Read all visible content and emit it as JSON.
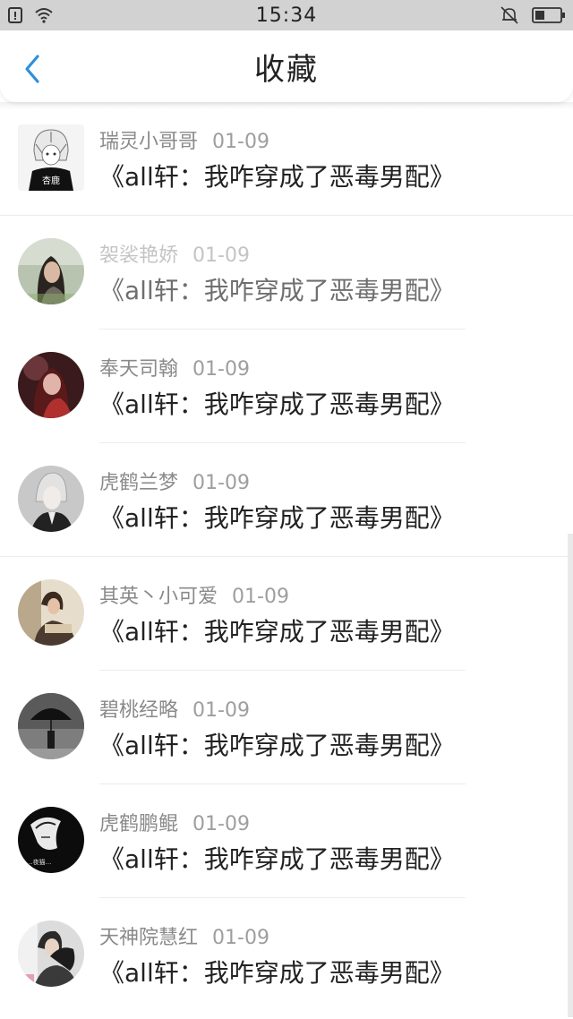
{
  "status_bar": {
    "time": "15:34",
    "icons_left": [
      "sim-icon",
      "wifi-icon"
    ],
    "icons_right": [
      "mute-icon",
      "battery-icon"
    ]
  },
  "nav": {
    "title": "收藏",
    "back_icon": "chevron-left-icon",
    "accent": "#2d8fdd"
  },
  "items": [
    {
      "author": "瑞灵小哥哥",
      "date": "01-09",
      "title": "《all轩：我咋穿成了恶毒男配》",
      "avatar": "avatar-anime"
    },
    {
      "author": "袈裟艳娇",
      "date": "01-09",
      "title": "《all轩：我咋穿成了恶毒男配》",
      "avatar": "avatar-girl-green"
    },
    {
      "author": "奉天司翰",
      "date": "01-09",
      "title": "《all轩：我咋穿成了恶毒男配》",
      "avatar": "avatar-girl-red"
    },
    {
      "author": "虎鹤兰梦",
      "date": "01-09",
      "title": "《all轩：我咋穿成了恶毒男配》",
      "avatar": "avatar-boy-gray"
    },
    {
      "author": "其英丶小可爱",
      "date": "01-09",
      "title": "《all轩：我咋穿成了恶毒男配》",
      "avatar": "avatar-girl-sofa"
    },
    {
      "author": "碧桃经略",
      "date": "01-09",
      "title": "《all轩：我咋穿成了恶毒男配》",
      "avatar": "avatar-umbrella"
    },
    {
      "author": "虎鹤鹏鲲",
      "date": "01-09",
      "title": "《all轩：我咋穿成了恶毒男配》",
      "avatar": "avatar-dark-portrait"
    },
    {
      "author": "天神院慧红",
      "date": "01-09",
      "title": "《all轩：我咋穿成了恶毒男配》",
      "avatar": "avatar-couple"
    }
  ]
}
